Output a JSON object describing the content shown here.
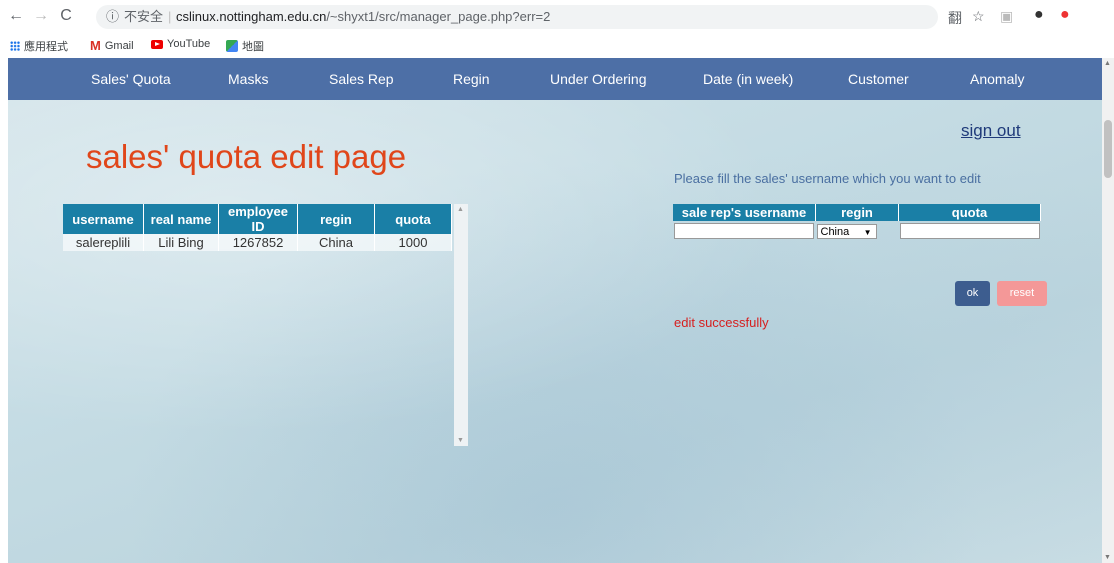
{
  "browser": {
    "insecure_label": "不安全",
    "url_host": "cslinux.nottingham.edu.cn",
    "url_path": "/~shyxt1/src/manager_page.php?err=2",
    "bookmarks": [
      "應用程式",
      "Gmail",
      "YouTube",
      "地圖"
    ]
  },
  "nav": {
    "items": [
      "Sales' Quota",
      "Masks",
      "Sales Rep",
      "Regin",
      "Under Ordering",
      "Date (in week)",
      "Customer",
      "Anomaly"
    ]
  },
  "page": {
    "sign_out": "sign out",
    "title": "sales' quota edit page",
    "hint": "Please fill the sales' username which you want to edit",
    "message": "edit successfully"
  },
  "list_table": {
    "headers": [
      "username",
      "real name",
      "employee ID",
      "regin",
      "quota"
    ],
    "rows": [
      [
        "salereplili",
        "Lili Bing",
        "1267852",
        "China",
        "1000"
      ]
    ]
  },
  "edit_form": {
    "headers": [
      "sale rep's username",
      "regin",
      "quota"
    ],
    "username_value": "",
    "regin_selected": "China",
    "quota_value": "",
    "ok_label": "ok",
    "reset_label": "reset"
  }
}
